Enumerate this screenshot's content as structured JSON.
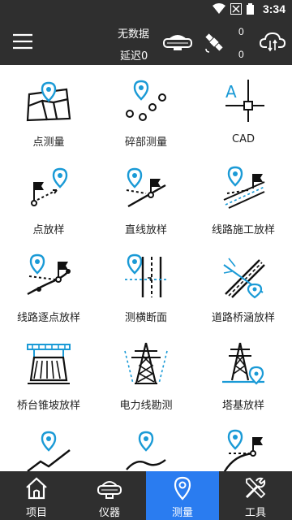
{
  "status": {
    "time": "3:34"
  },
  "header": {
    "line1": "无数据",
    "line2": "延迟0",
    "count1": "0",
    "count2": "0"
  },
  "colors": {
    "accent": "#1a9ad6",
    "bar": "#2f2f2f",
    "active": "#2a7cf0"
  },
  "grid": {
    "items": [
      {
        "label": "点测量"
      },
      {
        "label": "碎部测量"
      },
      {
        "label": "CAD",
        "icon_text": "A"
      },
      {
        "label": "点放样"
      },
      {
        "label": "直线放样"
      },
      {
        "label": "线路施工放样"
      },
      {
        "label": "线路逐点放样"
      },
      {
        "label": "测横断面"
      },
      {
        "label": "道路桥涵放样"
      },
      {
        "label": "桥台锥坡放样"
      },
      {
        "label": "电力线勘测"
      },
      {
        "label": "塔基放样"
      },
      {
        "label": ""
      },
      {
        "label": ""
      },
      {
        "label": ""
      }
    ]
  },
  "nav": [
    {
      "label": "项目",
      "icon": "home-icon"
    },
    {
      "label": "仪器",
      "icon": "receiver-icon"
    },
    {
      "label": "测量",
      "icon": "location-pin-icon",
      "active": true
    },
    {
      "label": "工具",
      "icon": "tools-icon"
    }
  ]
}
